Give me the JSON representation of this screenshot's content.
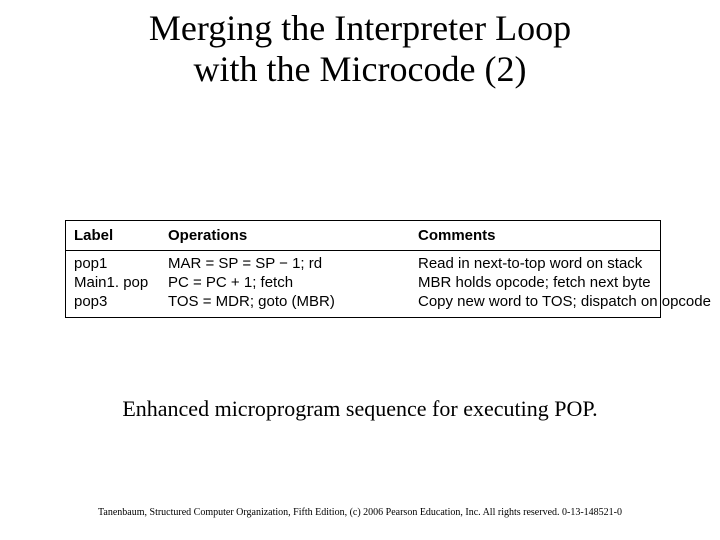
{
  "title_line1": "Merging the Interpreter Loop",
  "title_line2": "with the Microcode (2)",
  "table": {
    "headers": {
      "label": "Label",
      "operations": "Operations",
      "comments": "Comments"
    },
    "rows": [
      {
        "label": "pop1",
        "op": "MAR = SP = SP − 1; rd",
        "comment": "Read in next-to-top word on stack"
      },
      {
        "label": "Main1. pop",
        "op": "PC = PC + 1; fetch",
        "comment": "MBR holds opcode; fetch next byte"
      },
      {
        "label": "pop3",
        "op": "TOS = MDR; goto (MBR)",
        "comment": "Copy new word to TOS; dispatch on opcode"
      }
    ]
  },
  "caption": "Enhanced microprogram sequence for executing POP.",
  "footer": "Tanenbaum, Structured Computer Organization, Fifth Edition, (c) 2006 Pearson Education, Inc. All rights reserved. 0-13-148521-0"
}
